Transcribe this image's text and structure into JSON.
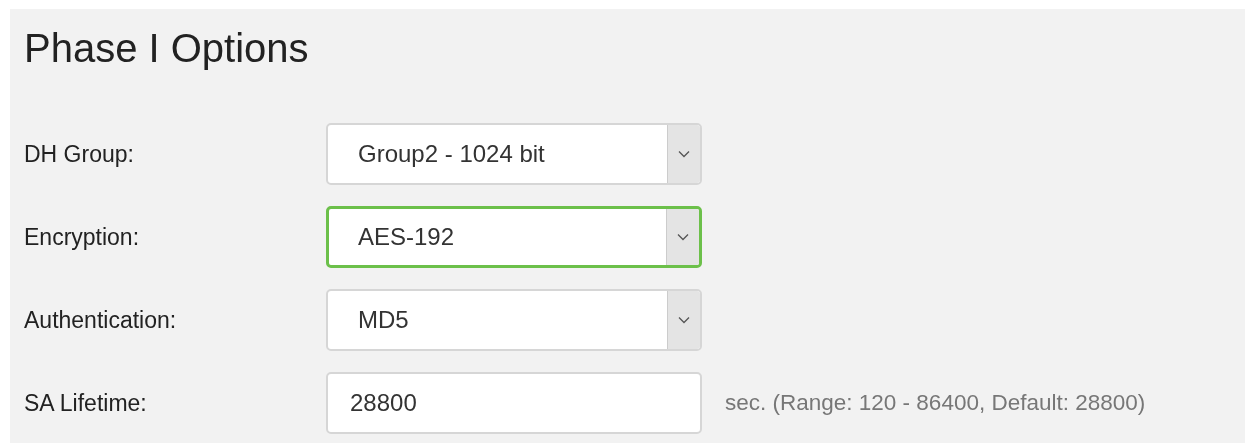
{
  "section": {
    "title": "Phase I Options"
  },
  "fields": [
    {
      "label": "DH Group:",
      "kind": "select",
      "value": "Group2 - 1024 bit",
      "focused": false
    },
    {
      "label": "Encryption:",
      "kind": "select",
      "value": "AES-192",
      "focused": true
    },
    {
      "label": "Authentication:",
      "kind": "select",
      "value": "MD5",
      "focused": false
    },
    {
      "label": "SA Lifetime:",
      "kind": "text",
      "value": "28800",
      "focused": false,
      "hint": "sec. (Range: 120 - 86400, Default: 28800)"
    }
  ]
}
